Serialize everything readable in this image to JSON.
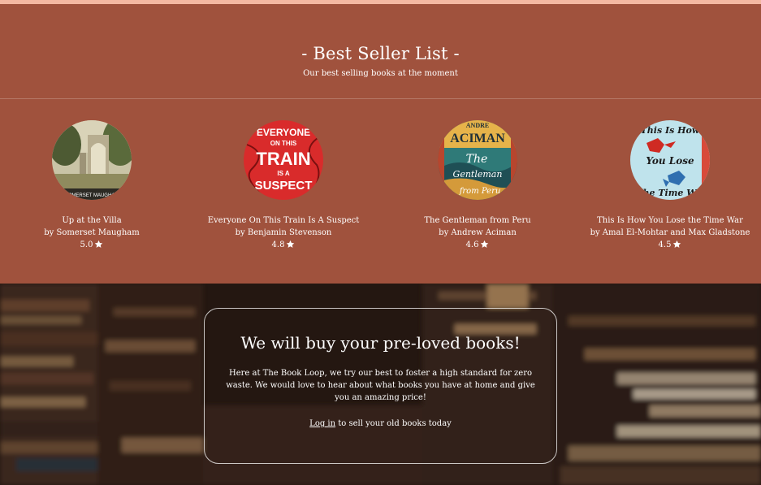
{
  "best_seller": {
    "title": "- Best Seller List -",
    "subtitle": "Our best selling books at the moment",
    "books": [
      {
        "title": "Up at the Villa",
        "author": "by Somerset Maugham",
        "rating": "5.0",
        "cover": "villa-cover-image"
      },
      {
        "title": "Everyone On This Train Is A Suspect",
        "author": "by Benjamin Stevenson",
        "rating": "4.8",
        "cover": "train-cover-image"
      },
      {
        "title": "The Gentleman from Peru",
        "author": "by Andrew Aciman",
        "rating": "4.6",
        "cover": "gentleman-cover-image"
      },
      {
        "title": "This Is How You Lose the Time War",
        "author": "by Amal El-Mohtar and Max Gladstone",
        "rating": "4.5",
        "cover": "time-war-cover-image"
      }
    ],
    "cover_text": {
      "villa": "SOMERSET MAUGHAM",
      "train_lines": [
        "EVERYONE",
        "ON THIS",
        "TRAIN",
        "IS A",
        "SUSPECT"
      ],
      "gentleman_lines": [
        "ANDRE",
        "ACIMAN",
        "The",
        "Gentleman",
        "from Peru"
      ],
      "time_war_lines": [
        "This Is How",
        "You Lose",
        "the Time War"
      ]
    }
  },
  "buy_books": {
    "title": "We will buy your pre-loved books!",
    "text": "Here at The Book Loop, we try our best to foster a high standard for zero waste. We would love to hear about what books you have at home and give you an amazing price!",
    "login_link": "Log in",
    "login_suffix": " to sell your old books today"
  },
  "colors": {
    "section_bg": "#a0523d",
    "top_strip": "#f4b8a2",
    "text": "#ffffff"
  },
  "icons": {
    "rating": "star-icon"
  }
}
